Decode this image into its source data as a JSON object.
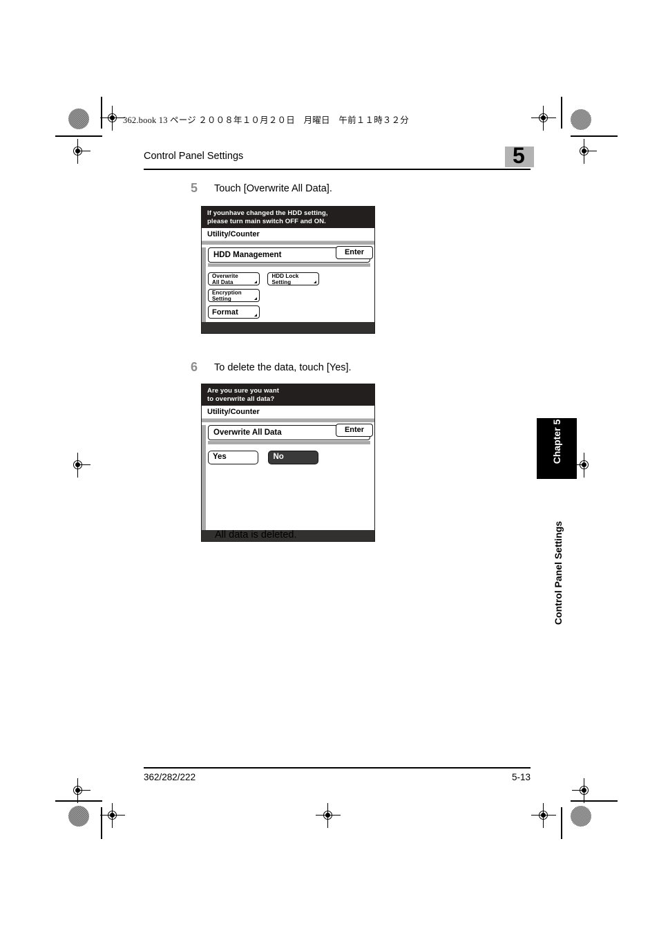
{
  "book_meta": "362.book  13 ページ  ２００８年１０月２０日　月曜日　午前１１時３２分",
  "header": {
    "title": "Control Panel Settings",
    "chapter_number": "5"
  },
  "steps": [
    {
      "number": "5",
      "text": "Touch [Overwrite All Data]."
    },
    {
      "number": "6",
      "text": "To delete the data, touch [Yes]."
    }
  ],
  "panels": {
    "hdd_management": {
      "message": "If younhave changed the HDD setting,\nplease turn main switch OFF and ON.",
      "title": "Utility/Counter",
      "section_label": "HDD Management",
      "enter_label": "Enter",
      "buttons": [
        {
          "label": "Overwrite\nAll Data"
        },
        {
          "label": "HDD Lock\nSetting"
        },
        {
          "label": "Encryption\nSetting"
        },
        {
          "label": "Format"
        }
      ]
    },
    "overwrite_confirm": {
      "message": "Are you sure you want\nto overwrite all data?",
      "title": "Utility/Counter",
      "section_label": "Overwrite All Data",
      "enter_label": "Enter",
      "yes_label": "Yes",
      "no_label": "No"
    }
  },
  "note": "All data is deleted.",
  "side": {
    "chapter_tab": "Chapter 5",
    "running_title": "Control Panel Settings"
  },
  "footer": {
    "model": "362/282/222",
    "page": "5-13"
  },
  "colors": {
    "message_bar": "#231f1f",
    "gray_band": "#a9a9a9",
    "chapter_box": "#b3b3b3",
    "step_number": "#8c8c8c",
    "selected_button": "#3a3a3a"
  }
}
